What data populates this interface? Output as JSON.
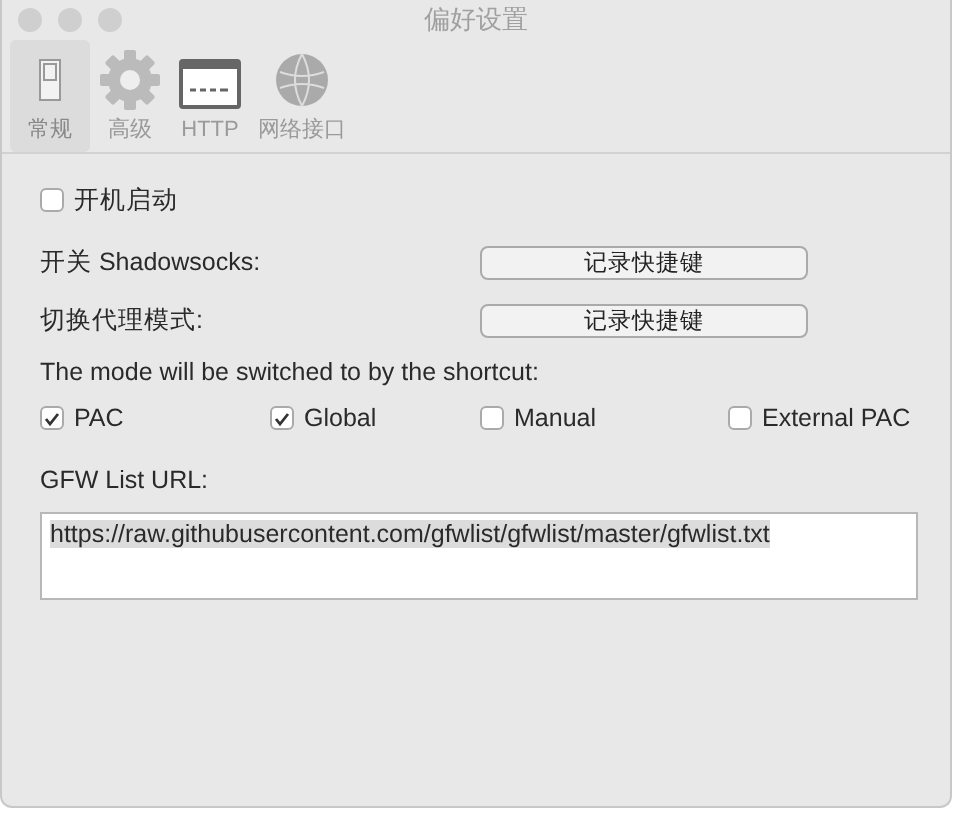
{
  "window": {
    "title": "偏好设置"
  },
  "tabs": [
    {
      "label": "常规",
      "kind": "switch",
      "selected": true
    },
    {
      "label": "高级",
      "kind": "gear",
      "selected": false
    },
    {
      "label": "HTTP",
      "kind": "http",
      "selected": false
    },
    {
      "label": "网络接口",
      "kind": "globe",
      "selected": false
    }
  ],
  "launch_at_login": {
    "label": "开机启动",
    "checked": false
  },
  "shortcuts": [
    {
      "label": "开关 Shadowsocks:",
      "button": "记录快捷键"
    },
    {
      "label": "切换代理模式:",
      "button": "记录快捷键"
    }
  ],
  "modes": {
    "label": "The mode will be switched to by the shortcut:",
    "options": [
      {
        "label": "PAC",
        "checked": true
      },
      {
        "label": "Global",
        "checked": true
      },
      {
        "label": "Manual",
        "checked": false
      },
      {
        "label": "External PAC",
        "checked": false
      }
    ]
  },
  "gfw": {
    "label": "GFW List URL:",
    "value": "https://raw.githubusercontent.com/gfwlist/gfwlist/master/gfwlist.txt"
  }
}
